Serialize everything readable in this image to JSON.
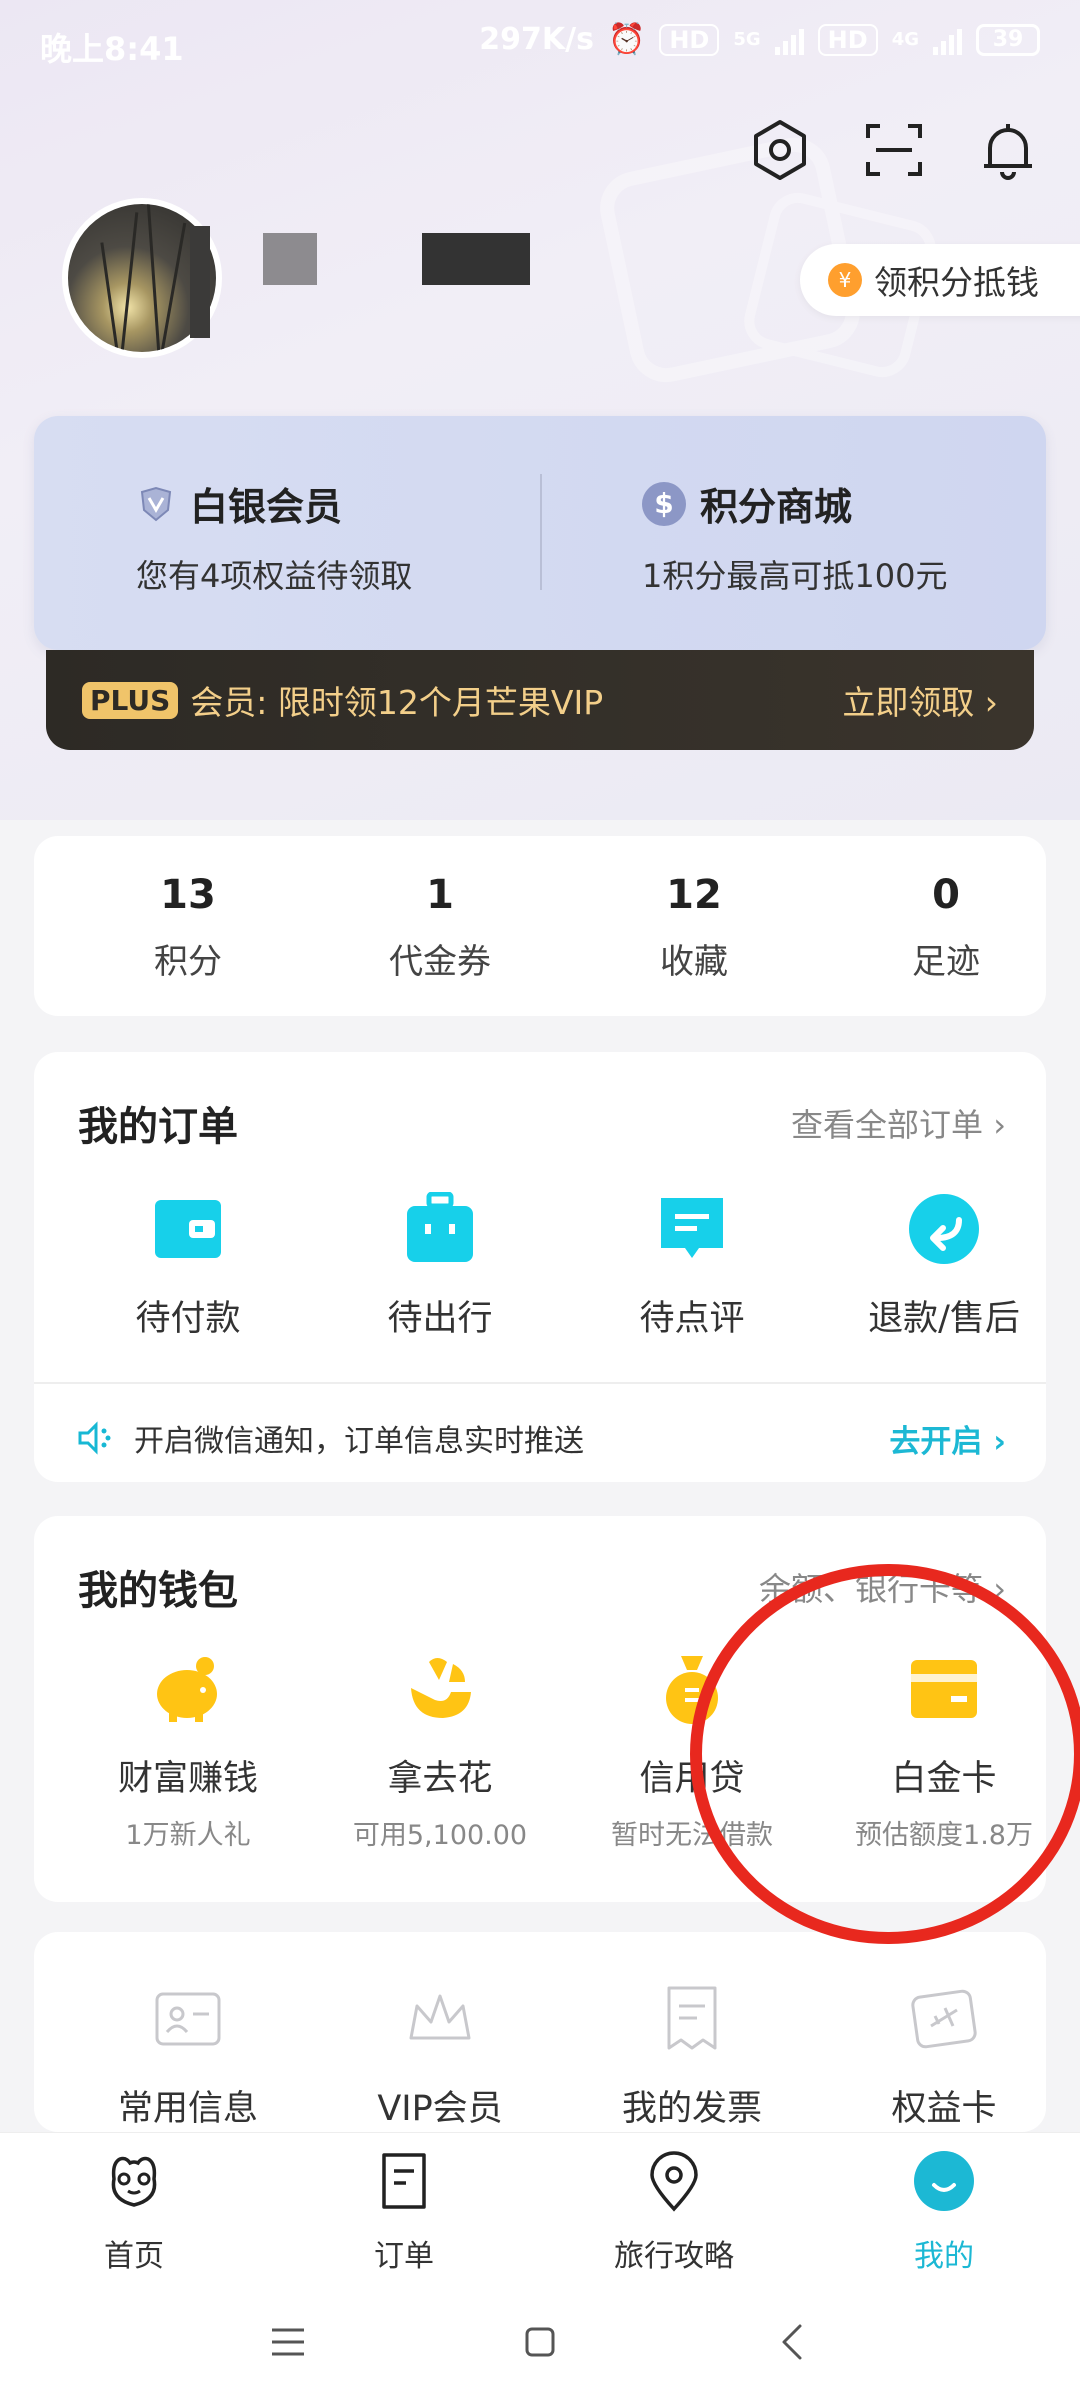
{
  "status_bar": {
    "time": "晚上8:41",
    "speed": "297K/s",
    "hd1": "HD",
    "net1": "5G",
    "hd2": "HD",
    "net2": "4G",
    "battery": "39"
  },
  "header": {
    "icons": [
      "settings-icon",
      "scan-icon",
      "bell-icon"
    ],
    "points_pill": "领积分抵钱"
  },
  "member": {
    "left_title": "白银会员",
    "left_sub": "您有4项权益待领取",
    "right_title": "积分商城",
    "right_sub": "1积分最高可抵100元",
    "plus_tag": "PLUS",
    "plus_text": "会员:  限时领12个月芒果VIP",
    "plus_claim": "立即领取 ›"
  },
  "stats": [
    {
      "value": "13",
      "label": "积分"
    },
    {
      "value": "1",
      "label": "代金券"
    },
    {
      "value": "12",
      "label": "收藏"
    },
    {
      "value": "0",
      "label": "足迹"
    }
  ],
  "orders": {
    "title": "我的订单",
    "link": "查看全部订单 ›",
    "items": [
      {
        "label": "待付款",
        "icon": "wallet-icon"
      },
      {
        "label": "待出行",
        "icon": "suitcase-icon"
      },
      {
        "label": "待点评",
        "icon": "comment-icon"
      },
      {
        "label": "退款/售后",
        "icon": "refund-icon"
      }
    ],
    "notify_text": "开启微信通知，订单信息实时推送",
    "notify_link": "去开启 ›"
  },
  "wallet": {
    "title": "我的钱包",
    "link": "余额、银行卡等 ›",
    "items": [
      {
        "label": "财富赚钱",
        "sub": "1万新人礼",
        "icon": "piggy-bank-icon"
      },
      {
        "label": "拿去花",
        "sub": "可用5,100.00",
        "icon": "flower-icon"
      },
      {
        "label": "信用贷",
        "sub": "暂时无法借款",
        "icon": "money-bag-icon"
      },
      {
        "label": "白金卡",
        "sub": "预估额度1.8万",
        "icon": "card-icon"
      }
    ]
  },
  "more_services": [
    {
      "label": "常用信息",
      "icon": "id-card-icon"
    },
    {
      "label": "VIP会员",
      "icon": "crown-icon"
    },
    {
      "label": "我的发票",
      "icon": "invoice-icon"
    },
    {
      "label": "权益卡",
      "icon": "plane-ticket-icon"
    }
  ],
  "bottom_nav": [
    {
      "label": "首页",
      "icon": "home-mascot-icon"
    },
    {
      "label": "订单",
      "icon": "order-doc-icon"
    },
    {
      "label": "旅行攻略",
      "icon": "location-pin-icon"
    },
    {
      "label": "我的",
      "icon": "profile-smile-icon",
      "active": true
    }
  ],
  "colors": {
    "accent": "#1cb8d4",
    "wallet_yellow": "#ffc414",
    "plus_gold": "#f3cf8a",
    "annotation_red": "#e8281e"
  }
}
